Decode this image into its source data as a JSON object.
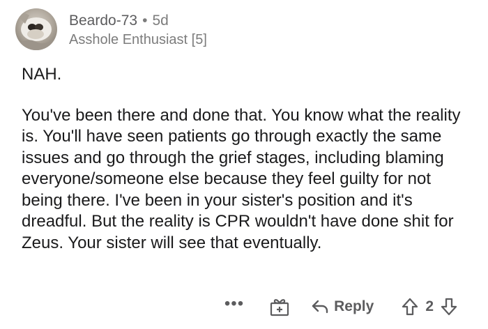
{
  "comment": {
    "author": "Beardo-73",
    "separator": "•",
    "age": "5d",
    "flair": "Asshole Enthusiast [5]",
    "paragraphs": [
      "NAH.",
      "You've been there and done that. You know what the reality is. You'll have seen patients go through exactly the same issues and go through the grief stages, including blaming everyone/someone else because they feel guilty for not being there. I've been in your sister's position and it's dreadful. But the reality is CPR wouldn't have done shit for Zeus. Your sister will see that eventually."
    ]
  },
  "actions": {
    "more_label": "•••",
    "reply_label": "Reply",
    "vote_count": "2"
  },
  "icons": {
    "more": "more-options-icon",
    "award": "award-icon",
    "reply": "reply-arrow-icon",
    "upvote": "upvote-arrow-icon",
    "downvote": "downvote-arrow-icon"
  }
}
